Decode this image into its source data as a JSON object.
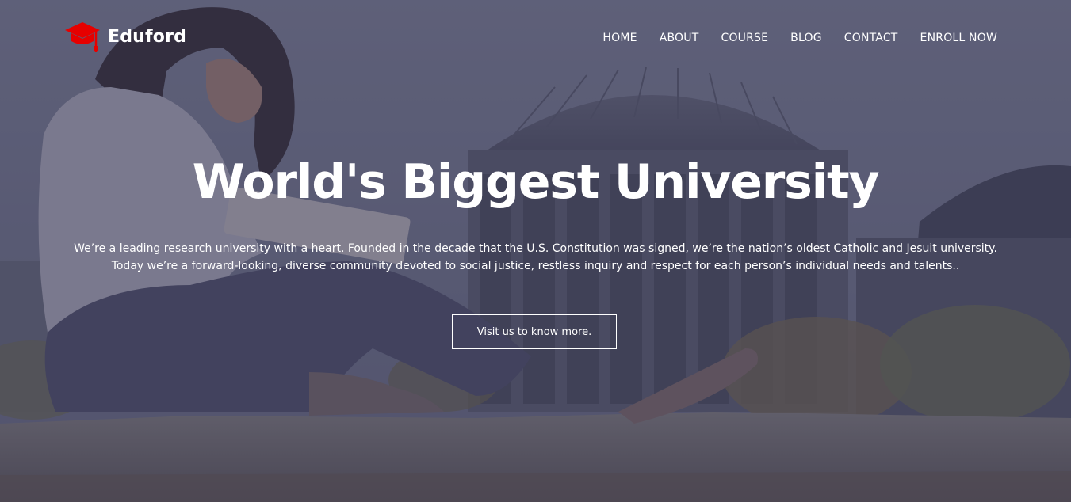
{
  "brand": {
    "name": "Eduford",
    "logo_icon": "graduation-cap-icon",
    "accent_color": "#e60000"
  },
  "nav": {
    "items": [
      {
        "label": "HOME"
      },
      {
        "label": "ABOUT"
      },
      {
        "label": "COURSE"
      },
      {
        "label": "BLOG"
      },
      {
        "label": "CONTACT"
      },
      {
        "label": "ENROLL NOW"
      }
    ]
  },
  "hero": {
    "headline": "World's Biggest University",
    "lead_line1": "We’re a leading research university with a heart. Founded in the decade that the U.S. Constitution was signed, we’re the nation’s oldest Catholic and Jesuit university.",
    "lead_line2": "Today we’re a forward-looking, diverse community devoted to social justice, restless inquiry and respect for each person’s individual needs and talents..",
    "cta_label": "Visit us to know more.",
    "overlay_color": "#3a3a54"
  }
}
